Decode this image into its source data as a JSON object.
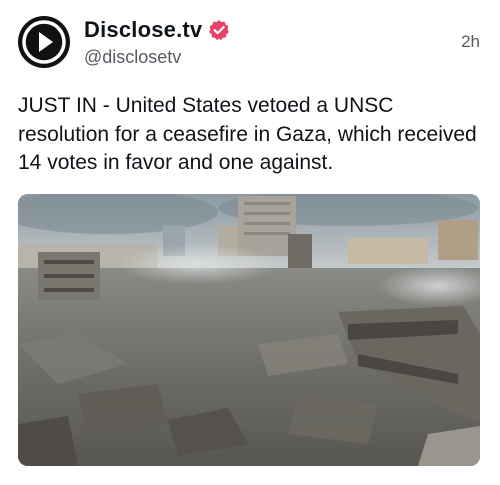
{
  "post": {
    "display_name": "Disclose.tv",
    "handle": "@disclosetv",
    "timestamp": "2h",
    "verified": true,
    "text": "JUST IN - United States vetoed a UNSC resolution for a ceasefire in Gaza, which received 14 votes in favor and one against."
  },
  "icons": {
    "avatar": "play-logo-icon",
    "verified": "verified-badge-icon"
  },
  "colors": {
    "verified_badge": "#e8426b",
    "avatar_bg": "#111111",
    "secondary_text": "#555b61"
  }
}
